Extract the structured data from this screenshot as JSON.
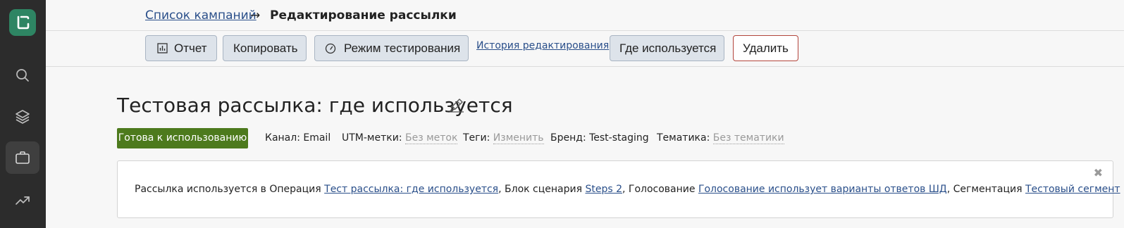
{
  "sidebar": {
    "items": [
      {
        "icon": "search-icon"
      },
      {
        "icon": "layers-icon"
      },
      {
        "icon": "briefcase-icon",
        "active": true
      },
      {
        "icon": "trending-up-icon"
      }
    ]
  },
  "breadcrumb": {
    "link": "Список кампаний",
    "arrow": "→",
    "current": "Редактирование рассылки"
  },
  "toolbar": {
    "report": "Отчет",
    "copy": "Копировать",
    "test_mode": "Режим тестирования",
    "history": "История редактирования",
    "where_used": "Где используется",
    "delete": "Удалить"
  },
  "page": {
    "title": "Тестовая рассылка: где используется"
  },
  "meta": {
    "status": "Готова к использованию",
    "channel": "Канал: Email",
    "utm_label": "UTM-метки:",
    "utm_value": "Без меток",
    "tags_label": "Теги:",
    "tags_value": "Изменить",
    "brand": "Бренд: Test-staging",
    "topic_label": "Тематика:",
    "topic_value": "Без тематики"
  },
  "notice": {
    "intro": "Рассылка используется в Операция ",
    "op_link": "Тест рассылка: где используется",
    "mid1": ", Блок сценария ",
    "block_link": "Steps 2",
    "mid2": ", Голосование ",
    "vote_link": "Голосование использует варианты ответов ШД",
    "mid3": ", Сегментация ",
    "segment_link": "Тестовый сегмент",
    "close": "✖"
  },
  "colors": {
    "sidebar": "#2c2c2c",
    "logo": "#2e8563",
    "status_green": "#4d7a1d",
    "link": "#2a4f8a",
    "danger_border": "#b3453c"
  }
}
